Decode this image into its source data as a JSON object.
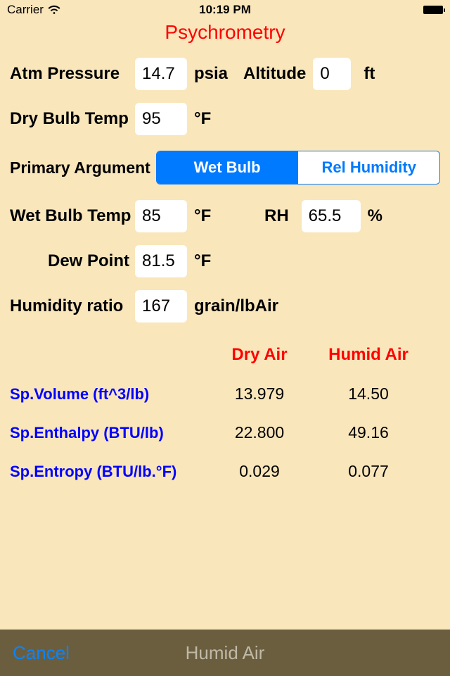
{
  "status": {
    "carrier": "Carrier",
    "time": "10:19 PM"
  },
  "title": "Psychrometry",
  "inputs": {
    "atm_pressure": {
      "label": "Atm Pressure",
      "value": "14.7",
      "unit": "psia"
    },
    "altitude": {
      "label": "Altitude",
      "value": "0",
      "unit": "ft"
    },
    "dry_bulb": {
      "label": "Dry Bulb Temp",
      "value": "95",
      "unit": "°F"
    },
    "primary_arg": {
      "label": "Primary Argument",
      "opt1": "Wet Bulb",
      "opt2": "Rel Humidity"
    },
    "wet_bulb": {
      "label": "Wet Bulb Temp",
      "value": "85",
      "unit": "°F"
    },
    "rh": {
      "label": "RH",
      "value": "65.5",
      "unit": "%"
    },
    "dew_point": {
      "label": "Dew Point",
      "value": "81.5",
      "unit": "°F"
    },
    "humidity_ratio": {
      "label": "Humidity ratio",
      "value": "167",
      "unit": "grain/lbAir"
    }
  },
  "results": {
    "headers": {
      "dry": "Dry Air",
      "humid": "Humid Air"
    },
    "rows": [
      {
        "label": "Sp.Volume (ft^3/lb)",
        "dry": "13.979",
        "humid": "14.50"
      },
      {
        "label": "Sp.Enthalpy (BTU/lb)",
        "dry": "22.800",
        "humid": "49.16"
      },
      {
        "label": "Sp.Entropy (BTU/lb.°F)",
        "dry": "0.029",
        "humid": "0.077"
      }
    ]
  },
  "bottom": {
    "cancel": "Cancel",
    "title": "Humid Air"
  }
}
